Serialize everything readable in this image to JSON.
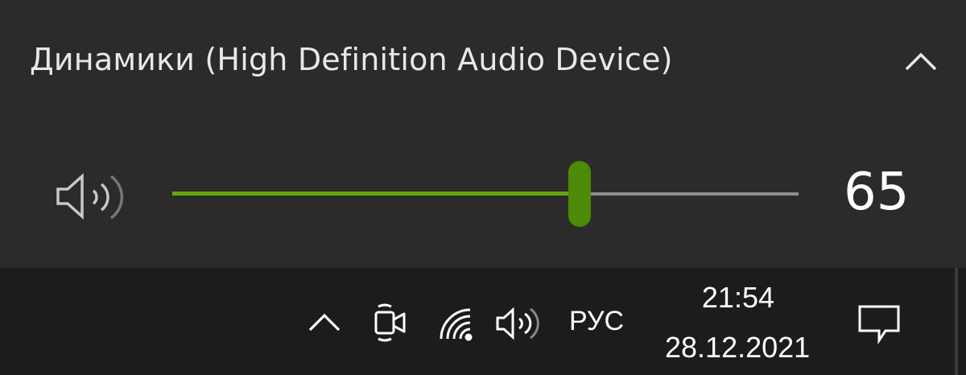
{
  "flyout": {
    "device_title": "Динамики (High Definition Audio Device)",
    "expand_icon": "chevron-up-icon",
    "speaker_icon": "speaker-icon",
    "volume": {
      "value": "65",
      "level": 65,
      "fill_color": "#64a70b",
      "thumb_color": "#4d8a05",
      "track_color": "#8d8d8d"
    }
  },
  "taskbar": {
    "show_hidden_icon": "chevron-up-icon",
    "meet_now_icon": "video-camera-icon",
    "network_icon": "wifi-icon",
    "volume_icon": "speaker-icon",
    "language": "РУС",
    "clock": {
      "time": "21:54",
      "date": "28.12.2021"
    },
    "notifications_icon": "action-center-icon"
  },
  "colors": {
    "flyout_bg": "#2b2b2b",
    "taskbar_bg": "#1c1c1c",
    "accent": "#64a70b"
  }
}
